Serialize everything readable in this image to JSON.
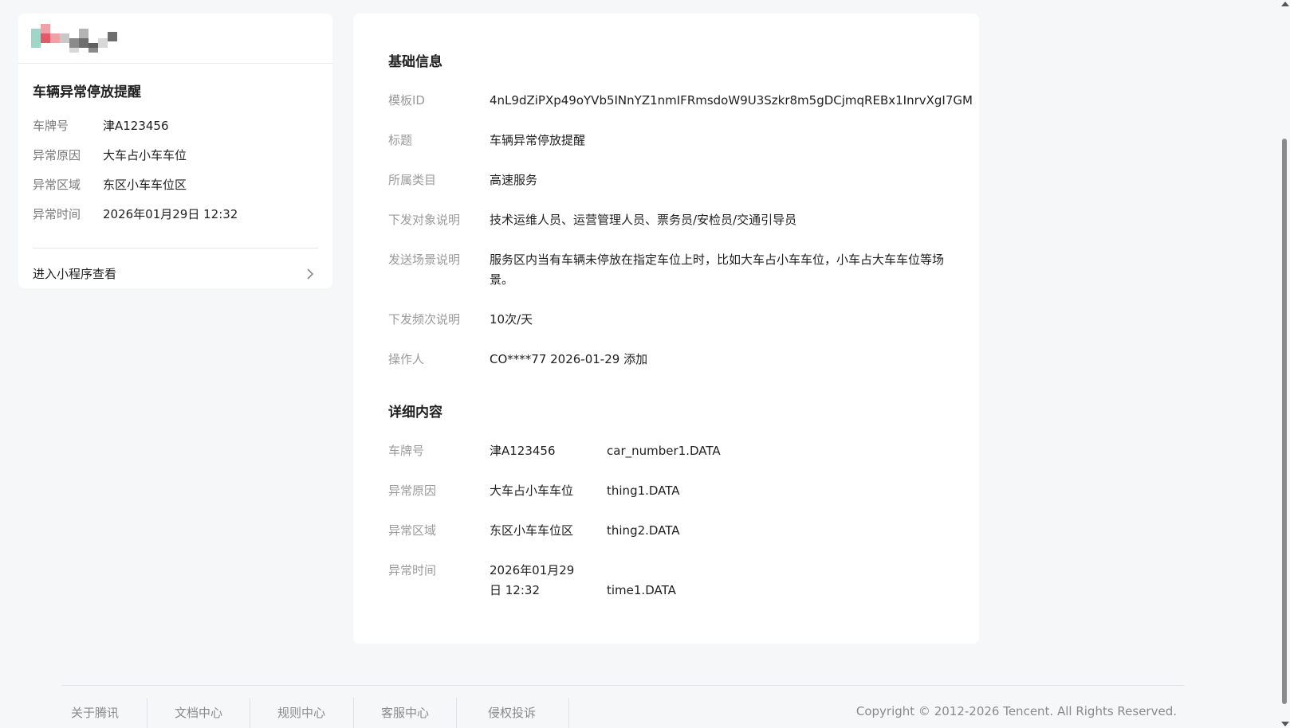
{
  "preview": {
    "title": "车辆异常停放提醒",
    "fields": [
      {
        "label": "车牌号",
        "value": "津A123456"
      },
      {
        "label": "异常原因",
        "value": "大车占小车车位"
      },
      {
        "label": "异常区域",
        "value": "东区小车车位区"
      },
      {
        "label": "异常时间",
        "value": "2026年01月29日 12:32"
      }
    ],
    "footer_link": "进入小程序查看",
    "avatar_colors": [
      "#9fd6c8",
      "#f2a0a8",
      "#e25a6a",
      "#c8c8c8",
      "#8a8a8a",
      "#b4b4b4",
      "#5f5f5f",
      "#d8d8d8",
      "#a0a0a0",
      "#6e6e6e"
    ]
  },
  "basic": {
    "section_title": "基础信息",
    "rows": [
      {
        "label": "模板ID",
        "value": "4nL9dZiPXp49oYVb5INnYZ1nmIFRmsdoW9U3Szkr8m5gDCjmqREBx1InrvXgI7GM"
      },
      {
        "label": "标题",
        "value": "车辆异常停放提醒"
      },
      {
        "label": "所属类目",
        "value": "高速服务"
      },
      {
        "label": "下发对象说明",
        "value": "技术运维人员、运营管理人员、票务员/安检员/交通引导员"
      },
      {
        "label": "发送场景说明",
        "value": "服务区内当有车辆未停放在指定车位上时，比如大车占小车车位，小车占大车车位等场景。"
      },
      {
        "label": "下发频次说明",
        "value": "10次/天"
      },
      {
        "label": "操作人",
        "value": "CO****77 2026-01-29 添加"
      }
    ]
  },
  "detail": {
    "section_title": "详细内容",
    "rows": [
      {
        "label": "车牌号",
        "value": "津A123456",
        "key": "car_number1.DATA"
      },
      {
        "label": "异常原因",
        "value": "大车占小车车位",
        "key": "thing1.DATA"
      },
      {
        "label": "异常区域",
        "value": "东区小车车位区",
        "key": "thing2.DATA"
      },
      {
        "label": "异常时间",
        "value": "2026年01月29日 12:32",
        "key": "time1.DATA"
      }
    ]
  },
  "footer": {
    "links": [
      "关于腾讯",
      "文档中心",
      "规则中心",
      "客服中心",
      "侵权投诉"
    ],
    "copyright": "Copyright © 2012-2026 Tencent. All Rights Reserved."
  }
}
